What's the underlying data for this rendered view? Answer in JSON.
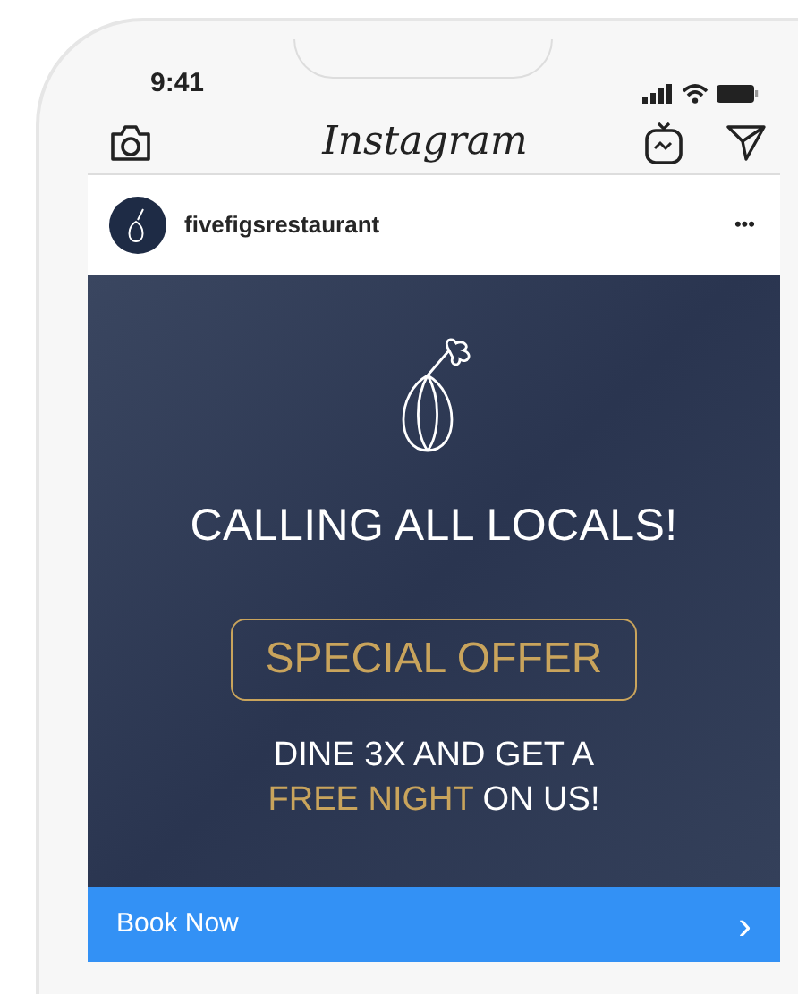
{
  "status_bar": {
    "time": "9:41"
  },
  "app_bar": {
    "title": "Instagram"
  },
  "post": {
    "username": "fivefigsrestaurant",
    "more": "•••",
    "ad": {
      "headline": "CALLING ALL LOCALS!",
      "badge": "SPECIAL OFFER",
      "offer_lines": [
        [
          {
            "text": "DINE 3X AND GET A",
            "highlight": false
          }
        ],
        [
          {
            "text": "FREE NIGHT",
            "highlight": true
          },
          {
            "text": "ON US!",
            "highlight": false
          }
        ]
      ]
    },
    "cta": {
      "label": "Book Now",
      "chevron": "›"
    }
  }
}
